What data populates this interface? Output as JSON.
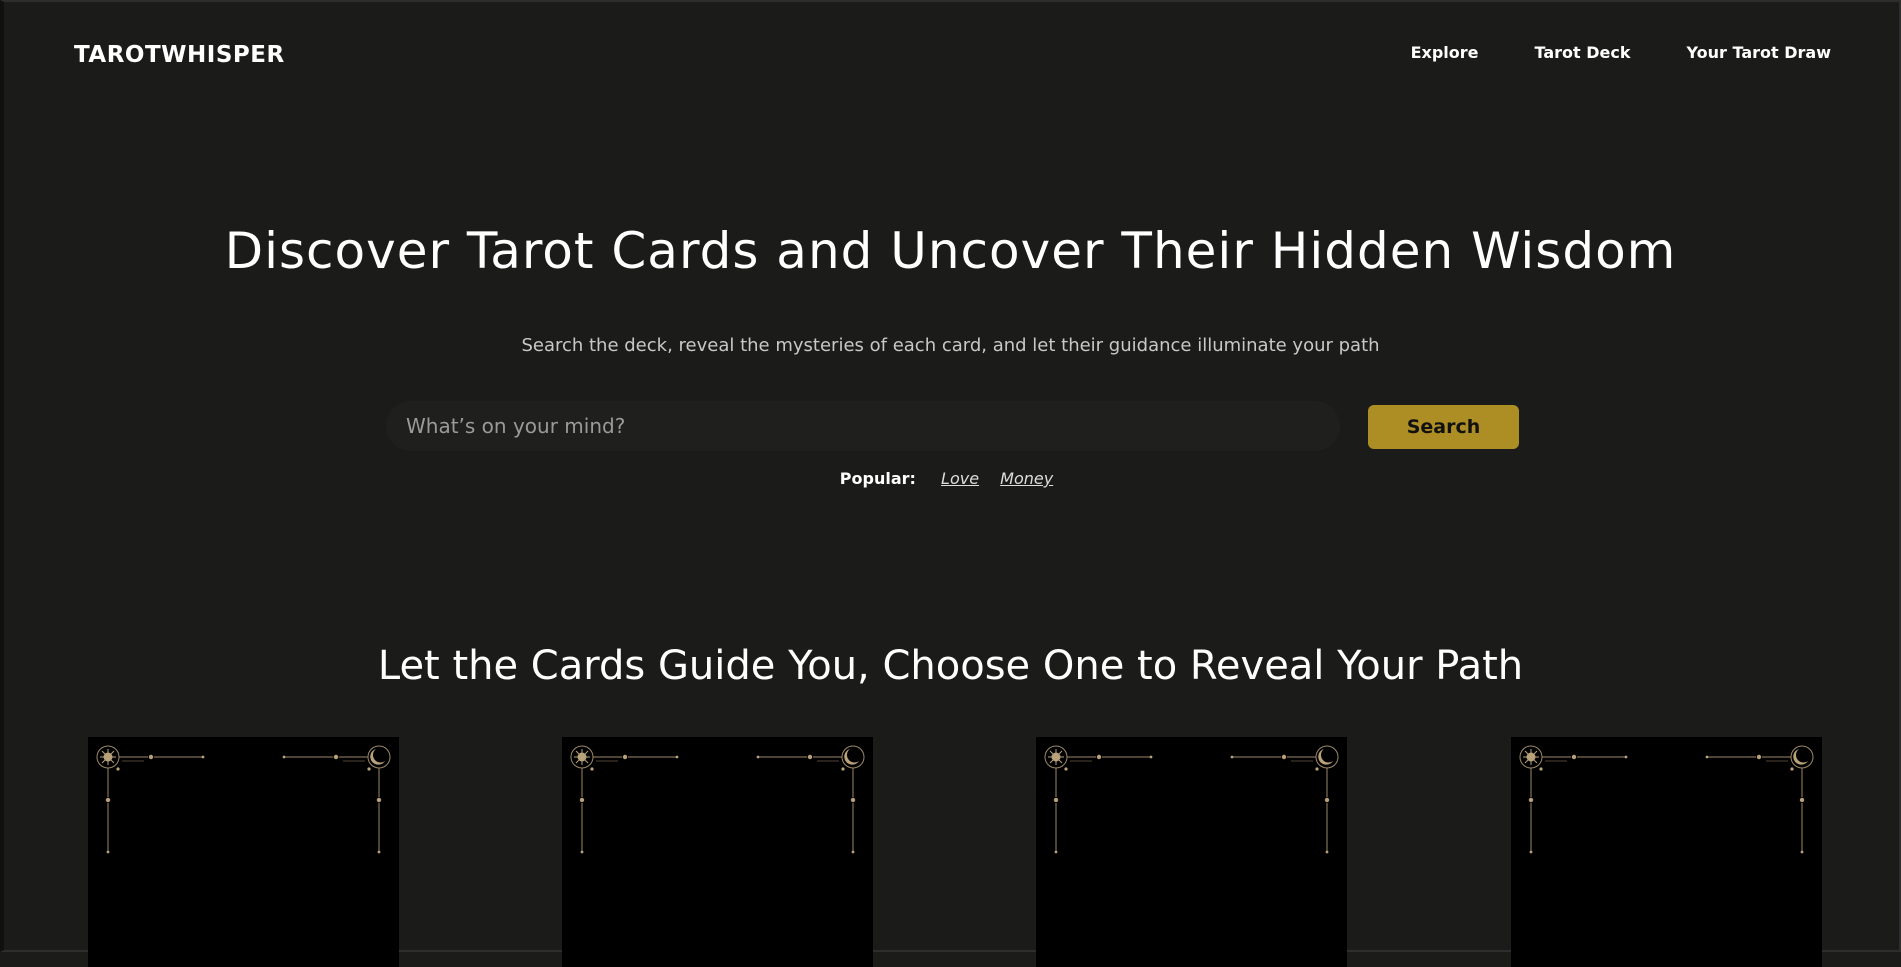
{
  "header": {
    "brand": "TAROTWHISPER",
    "nav": [
      "Explore",
      "Tarot Deck",
      "Your Tarot Draw"
    ]
  },
  "hero": {
    "title": "Discover Tarot Cards and Uncover Their Hidden Wisdom",
    "subtitle": "Search the deck, reveal the mysteries of each card, and let their guidance illuminate your path",
    "search": {
      "placeholder": "What’s on your mind?",
      "button_label": "Search"
    },
    "popular": {
      "label": "Popular:",
      "tags": [
        "Love",
        "Money"
      ]
    }
  },
  "cards_section": {
    "title": "Let the Cards Guide You, Choose One to Reveal Your Path",
    "card_count": 4
  },
  "colors": {
    "background": "#1b1b1a",
    "accent": "#ad8e25",
    "card": "#000000",
    "ornament": "#b9a27a"
  }
}
